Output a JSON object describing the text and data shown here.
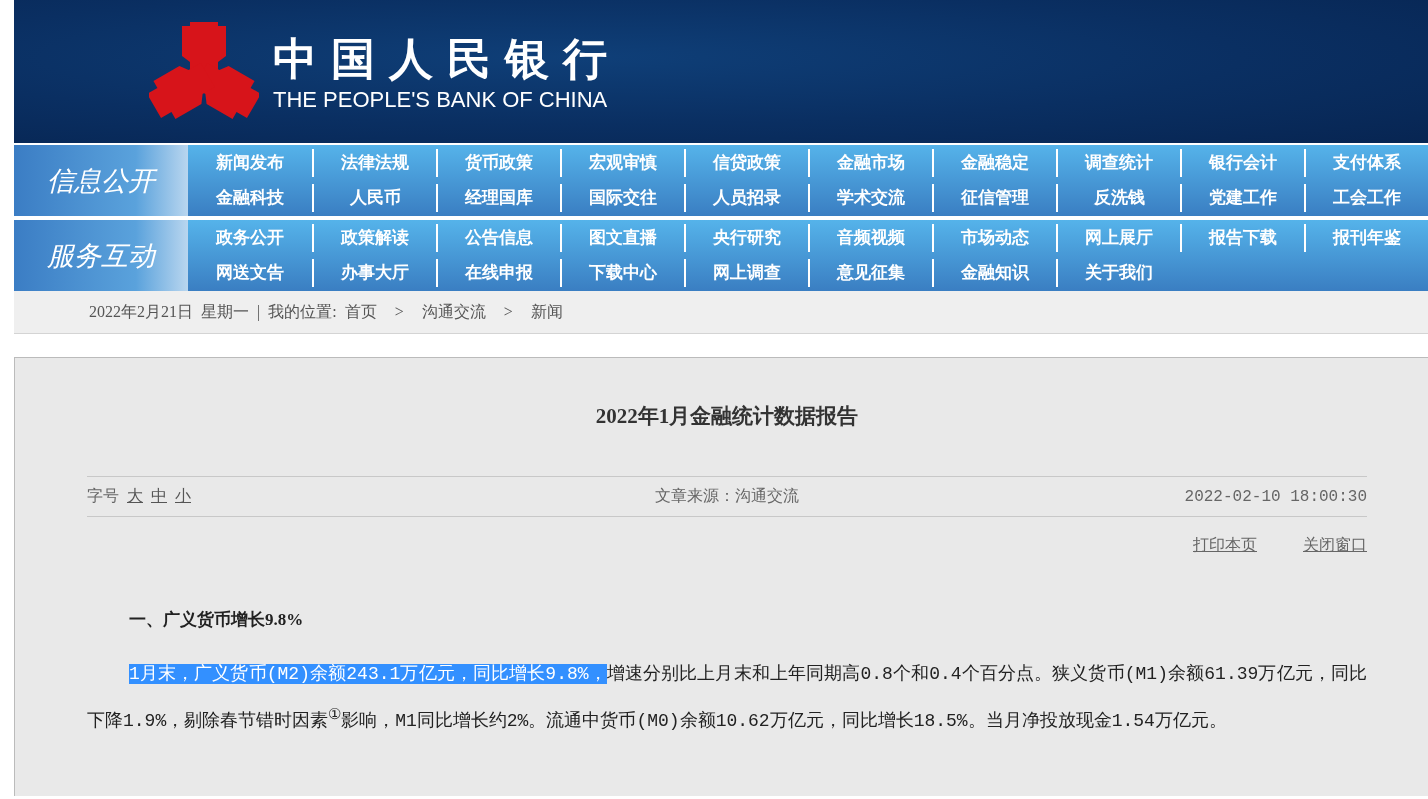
{
  "header": {
    "title_cn": "中国人民银行",
    "title_en": "THE PEOPLE'S BANK OF CHINA"
  },
  "nav_sections": [
    {
      "title": "信息公开",
      "rows": [
        [
          "新闻发布",
          "法律法规",
          "货币政策",
          "宏观审慎",
          "信贷政策",
          "金融市场",
          "金融稳定",
          "调查统计",
          "银行会计",
          "支付体系"
        ],
        [
          "金融科技",
          "人民币",
          "经理国库",
          "国际交往",
          "人员招录",
          "学术交流",
          "征信管理",
          "反洗钱",
          "党建工作",
          "工会工作"
        ]
      ]
    },
    {
      "title": "服务互动",
      "rows": [
        [
          "政务公开",
          "政策解读",
          "公告信息",
          "图文直播",
          "央行研究",
          "音频视频",
          "市场动态",
          "网上展厅",
          "报告下载",
          "报刊年鉴"
        ],
        [
          "网送文告",
          "办事大厅",
          "在线申报",
          "下载中心",
          "网上调查",
          "意见征集",
          "金融知识",
          "关于我们"
        ]
      ]
    }
  ],
  "breadcrumb": {
    "date": "2022年2月21日",
    "weekday": "星期一",
    "separator": "|",
    "location_label": "我的位置:",
    "items": [
      "首页",
      "沟通交流",
      "新闻"
    ],
    "arrow": ">"
  },
  "article": {
    "title": "2022年1月金融统计数据报告",
    "font_size": {
      "label": "字号",
      "options": [
        "大",
        "中",
        "小"
      ]
    },
    "source": "文章来源：沟通交流",
    "datetime": "2022-02-10 18:00:30",
    "actions": [
      "打印本页",
      "关闭窗口"
    ],
    "heading": "一、广义货币增长9.8%",
    "paragraph": [
      {
        "text": "1月末，广义货币(M2)余额243.1万亿元，同比增长9.8%，",
        "selected": true
      },
      {
        "text": "增速分别比上月末和上年同期高0.8个和0.4个百分点。狭义货币(M1)余额61.39万亿元，同比下降1.9%，剔除春节错时因素$^{①}$影响，M1同比增长约2%。流通中货币(M0)余额10.62万亿元，同比增长18.5%。当月净投放现金1.54万亿元。",
        "selected": false
      }
    ]
  }
}
